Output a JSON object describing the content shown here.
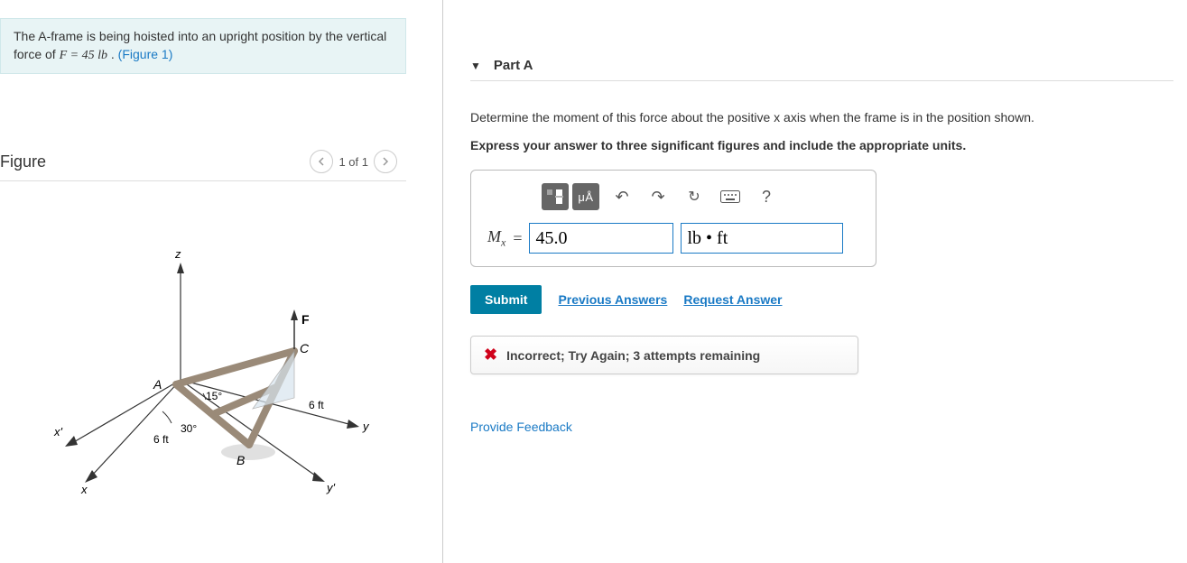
{
  "problem": {
    "text_before": "The A-frame is being hoisted into an upright position by the vertical force of ",
    "force_var": "F",
    "equals": " = 45  lb",
    "text_after": " . ",
    "figure_link": "(Figure 1)"
  },
  "figure": {
    "title": "Figure",
    "nav_label": "1 of 1",
    "labels": {
      "z": "z",
      "x": "x",
      "xp": "x'",
      "y": "y",
      "yp": "y'",
      "A": "A",
      "B": "B",
      "C": "C",
      "F": "F",
      "ang15": "15°",
      "ang30": "30°",
      "len1": "6 ft",
      "len2": "6 ft"
    }
  },
  "part": {
    "label": "Part A",
    "instruction": "Determine the moment of this force about the positive x axis when the frame is in the position shown.",
    "instruction_bold": "Express your answer to three significant figures and include the appropriate units."
  },
  "answer": {
    "prefix": "M",
    "sub": "x",
    "eq": " = ",
    "value": "45.0",
    "units": "lb • ft"
  },
  "toolbar": {
    "frac_icon": "frac",
    "units_icon": "μÅ",
    "undo_icon": "↶",
    "redo_icon": "↷",
    "reset_icon": "↻",
    "keyboard_icon": "⌨",
    "help_icon": "?"
  },
  "actions": {
    "submit": "Submit",
    "previous": "Previous Answers",
    "request": "Request Answer"
  },
  "feedback": {
    "x": "✖",
    "text": "Incorrect; Try Again; 3 attempts remaining"
  },
  "provide_feedback": "Provide Feedback"
}
